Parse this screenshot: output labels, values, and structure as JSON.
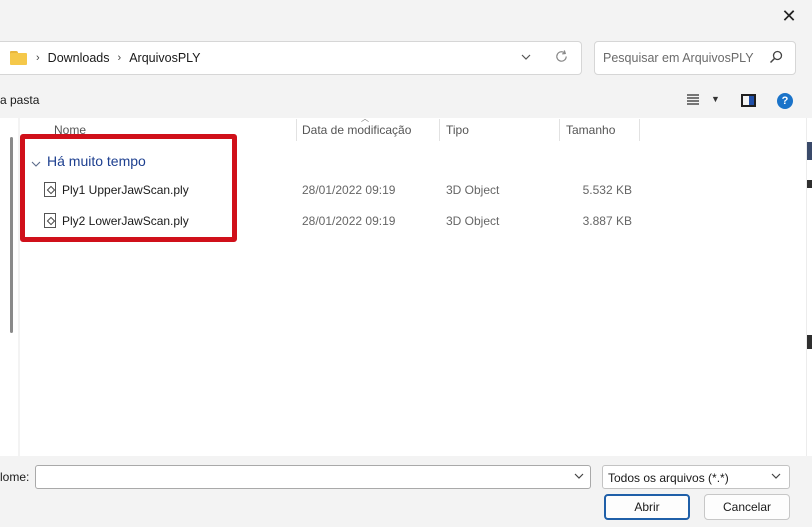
{
  "window": {
    "close_glyph": "✕"
  },
  "address": {
    "breadcrumbs": [
      "Downloads",
      "ArquivosPLY"
    ],
    "separator": "›"
  },
  "search": {
    "placeholder": "Pesquisar em ArquivosPLY"
  },
  "toolbar": {
    "new_folder_fragment": "a pasta",
    "help_glyph": "?"
  },
  "columns": [
    {
      "label": "Nome"
    },
    {
      "label": "Data de modificação"
    },
    {
      "label": "Tipo"
    },
    {
      "label": "Tamanho"
    }
  ],
  "group": {
    "label": "Há muito tempo"
  },
  "files": [
    {
      "name": "Ply1 UpperJawScan.ply",
      "modified": "28/01/2022 09:19",
      "type": "3D Object",
      "size": "5.532 KB"
    },
    {
      "name": "Ply2 LowerJawScan.ply",
      "modified": "28/01/2022 09:19",
      "type": "3D Object",
      "size": "3.887 KB"
    }
  ],
  "bottom": {
    "name_label": "lome:",
    "name_value": "",
    "filter_value": "Todos os arquivos (*.*)",
    "open_label": "Abrir",
    "cancel_label": "Cancelar"
  },
  "colors": {
    "highlight": "#d0101a",
    "group_header": "#1d3f8f",
    "primary_button_border": "#1f5fa8",
    "folder": "#f5c84a"
  }
}
